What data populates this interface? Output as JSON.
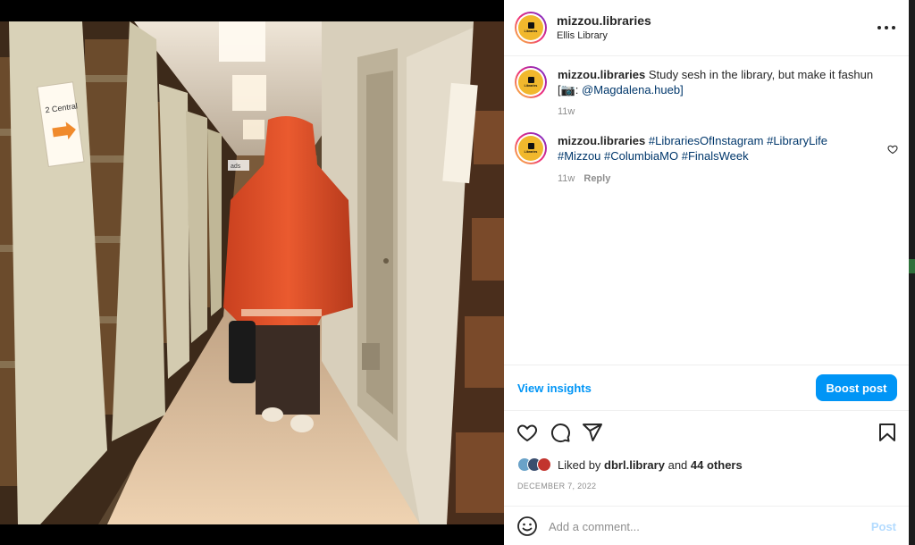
{
  "post_header": {
    "username": "mizzou.libraries",
    "location": "Ellis Library",
    "avatar_text": "Libraries",
    "more_icon": "more-horizontal-icon"
  },
  "photo": {
    "sign_text": "2 Central",
    "label_text": "ads",
    "colors": {
      "coat": "#e0512b",
      "shelf": "#d9d2b8",
      "floor": "#e8c7a3"
    }
  },
  "comments": [
    {
      "username": "mizzou.libraries",
      "text": "Study sesh in the library, but make it fashun [📷:",
      "mention": "@Magdalena.hueb]",
      "age": "11w"
    },
    {
      "username": "mizzou.libraries",
      "hashtags": "#LibrariesOfInstagram #LibraryLife #Mizzou #ColumbiaMO #FinalsWeek",
      "age": "11w",
      "reply_label": "Reply"
    }
  ],
  "insights": {
    "view_label": "View insights",
    "boost_label": "Boost post"
  },
  "likes": {
    "prefix": "Liked by",
    "user": "dbrl.library",
    "joiner": "and",
    "others": "44 others"
  },
  "date": "DECEMBER 7, 2022",
  "add_comment": {
    "placeholder": "Add a comment...",
    "post_label": "Post"
  },
  "colors": {
    "accent": "#0095f6",
    "link": "#00376b",
    "muted": "#8e8e8e"
  }
}
